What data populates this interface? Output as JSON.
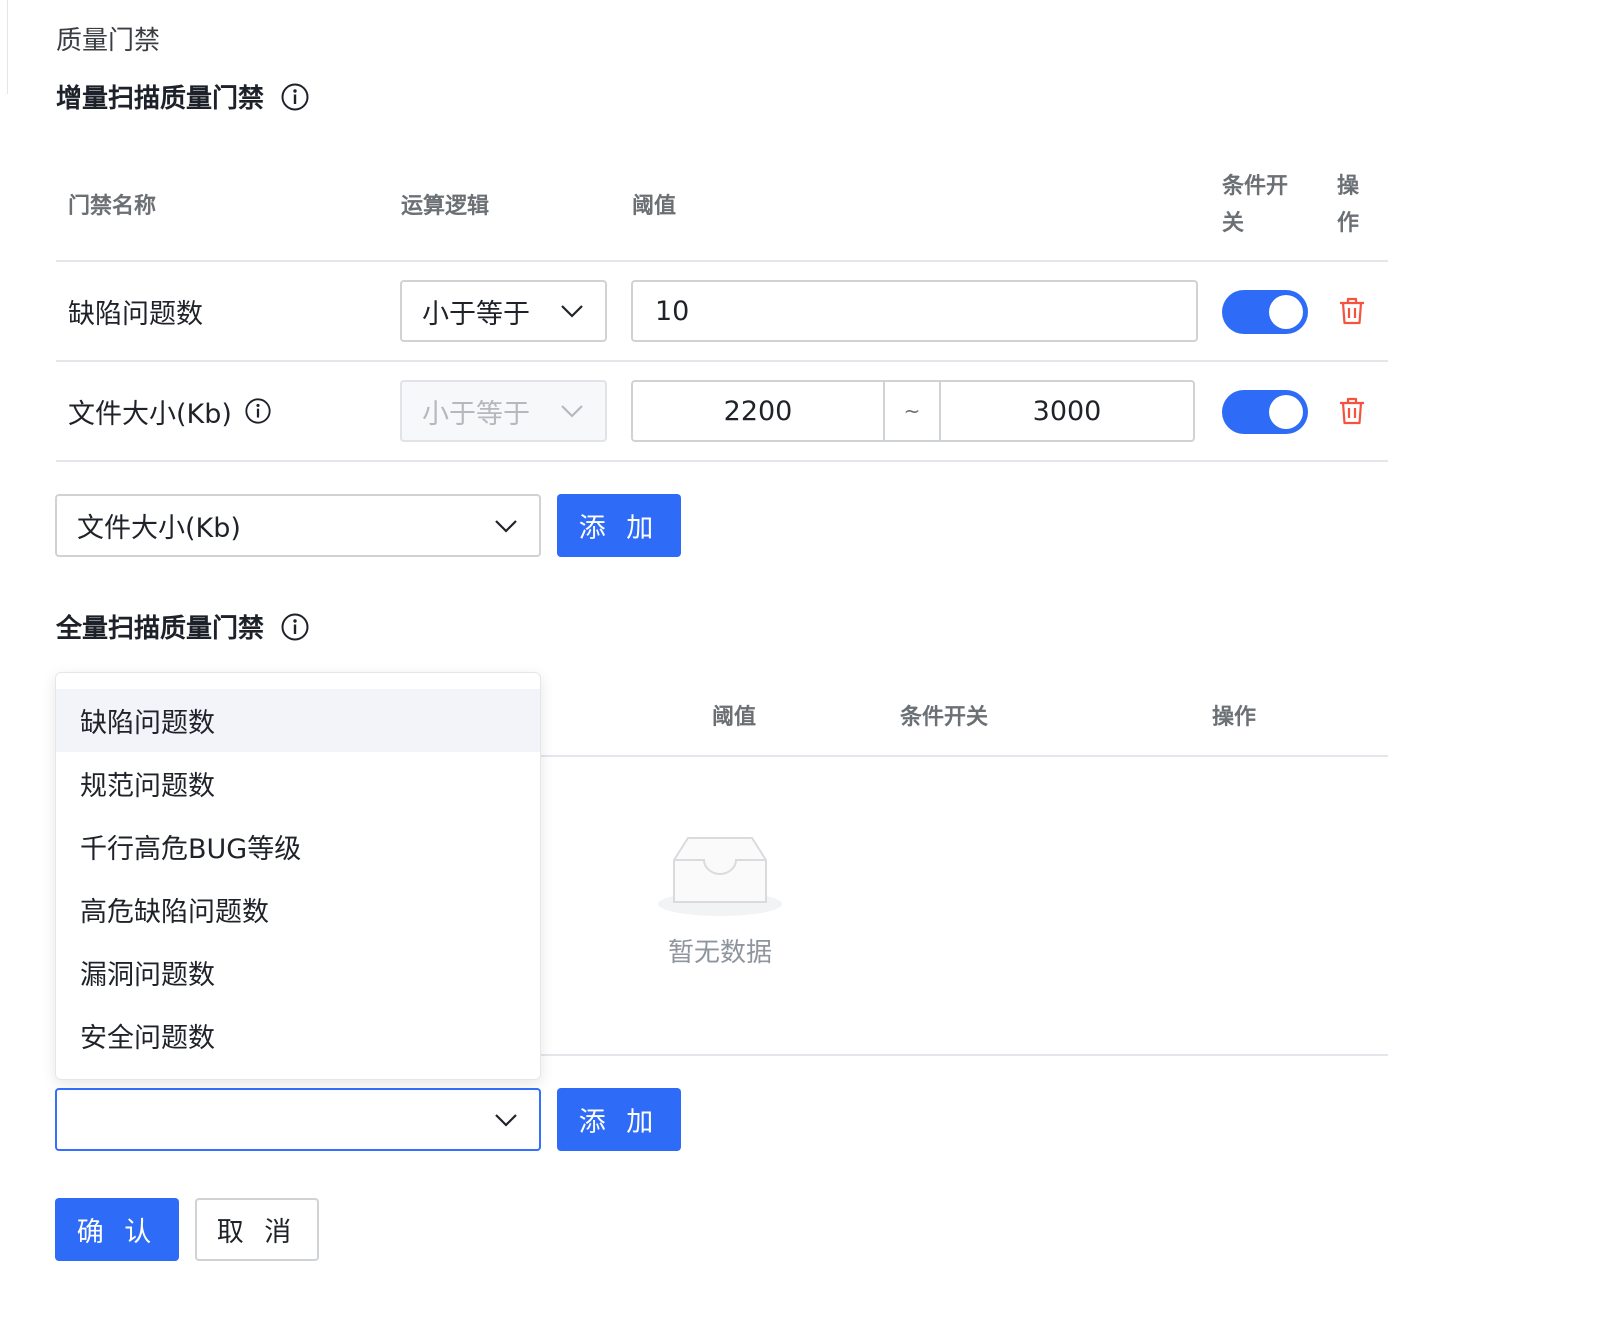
{
  "page_title": "质量门禁",
  "incremental": {
    "title": "增量扫描质量门禁",
    "headers": {
      "name": "门禁名称",
      "logic": "运算逻辑",
      "threshold": "阈值",
      "switch_line1": "条件开",
      "switch_line2": "关",
      "action_line1": "操",
      "action_line2": "作"
    },
    "rows": [
      {
        "name": "缺陷问题数",
        "operator": "小于等于",
        "value": "10",
        "enabled": true
      },
      {
        "name": "文件大小(Kb)",
        "operator": "小于等于",
        "range_min": "2200",
        "range_sep": "~",
        "range_max": "3000",
        "enabled": true
      }
    ],
    "add_select_value": "文件大小(Kb)",
    "add_button": "添 加"
  },
  "full": {
    "title": "全量扫描质量门禁",
    "headers": {
      "threshold": "阈值",
      "switch": "条件开关",
      "action": "操作"
    },
    "empty_text": "暂无数据",
    "add_select_value": "",
    "add_button": "添 加",
    "dropdown_options": [
      "缺陷问题数",
      "规范问题数",
      "千行高危BUG等级",
      "高危缺陷问题数",
      "漏洞问题数",
      "安全问题数"
    ]
  },
  "footer": {
    "confirm": "确 认",
    "cancel": "取 消"
  },
  "colors": {
    "primary": "#2e6bf6",
    "danger": "#f5533d",
    "border": "#d0d3d6",
    "divider": "#e5e6eb"
  }
}
